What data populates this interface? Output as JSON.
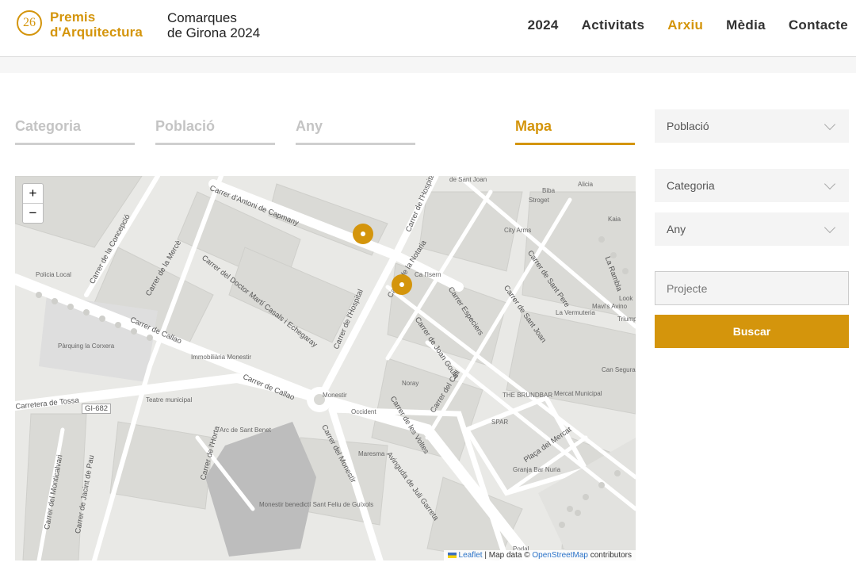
{
  "header": {
    "logo_number": "26",
    "logo_line1": "Premis",
    "logo_line2": "d'Arquitectura",
    "subtitle_line1": "Comarques",
    "subtitle_line2": "de Girona 2024",
    "nav": [
      {
        "label": "2024",
        "active": false
      },
      {
        "label": "Activitats",
        "active": false
      },
      {
        "label": "Arxiu",
        "active": true
      },
      {
        "label": "Mèdia",
        "active": false
      },
      {
        "label": "Contacte",
        "active": false
      }
    ]
  },
  "tabs": [
    {
      "label": "Categoria",
      "active": false
    },
    {
      "label": "Població",
      "active": false
    },
    {
      "label": "Any",
      "active": false
    },
    {
      "label": "Mapa",
      "active": true
    }
  ],
  "map": {
    "zoom_in": "+",
    "zoom_out": "−",
    "attribution_leaflet": "Leaflet",
    "attribution_mid": " | Map data © ",
    "attribution_osm": "OpenStreetMap",
    "attribution_end": " contributors",
    "streets": [
      "Carrer d'Antoni de Capmany",
      "Carrer de la Concepció",
      "Carrer de la Mercè",
      "Carrer del Doctor Martí Casals i Echegaray",
      "Carrer de Callao",
      "Carrer de Callao",
      "Carretera de Tossa",
      "GI-682",
      "Carrer de l'Hospital",
      "Carrer de l'Hospital",
      "Carrer de la Notaria",
      "Carrer Especiers",
      "Carrer de Joan Goula",
      "Carrer del Call",
      "Carrer de les Voltes",
      "Carrer del Monestir",
      "Avinguda de Juli Garreta",
      "Carrer de l'Horta",
      "Carrer del Monticalvari",
      "Carrer de Jacint de Pau",
      "Carrer de Sant Pere",
      "Carrer de Sant Joan",
      "Plaça del Mercat",
      "La Rambla"
    ],
    "pois": [
      "Policia Local",
      "Pàrquing la Corxera",
      "Immobiliària Monestir",
      "Teatre municipal",
      "Arc de Sant Benet",
      "Monestir benedictí Sant Feliu de Guíxols",
      "Monestir",
      "Occident",
      "Maresma",
      "Noray",
      "THE BRUNDBAR",
      "Mercat Municipal",
      "SPAR",
      "Granja Bar Nuria",
      "Ca l'Isern",
      "City Arms",
      "La Vermuteria",
      "Mavi's Avino",
      "Can Segura",
      "Biba",
      "Stroget",
      "de Sant Joan",
      "Kaia",
      "Alicia",
      "Look",
      "Triump",
      "Podal"
    ]
  },
  "filters": {
    "poblacio": "Població",
    "categoria": "Categoria",
    "any": "Any",
    "projecte_placeholder": "Projecte",
    "search_button": "Buscar"
  },
  "colors": {
    "accent": "#d4950c",
    "tab_inactive": "#c4c4c4",
    "map_bg": "#e9e9e6"
  }
}
